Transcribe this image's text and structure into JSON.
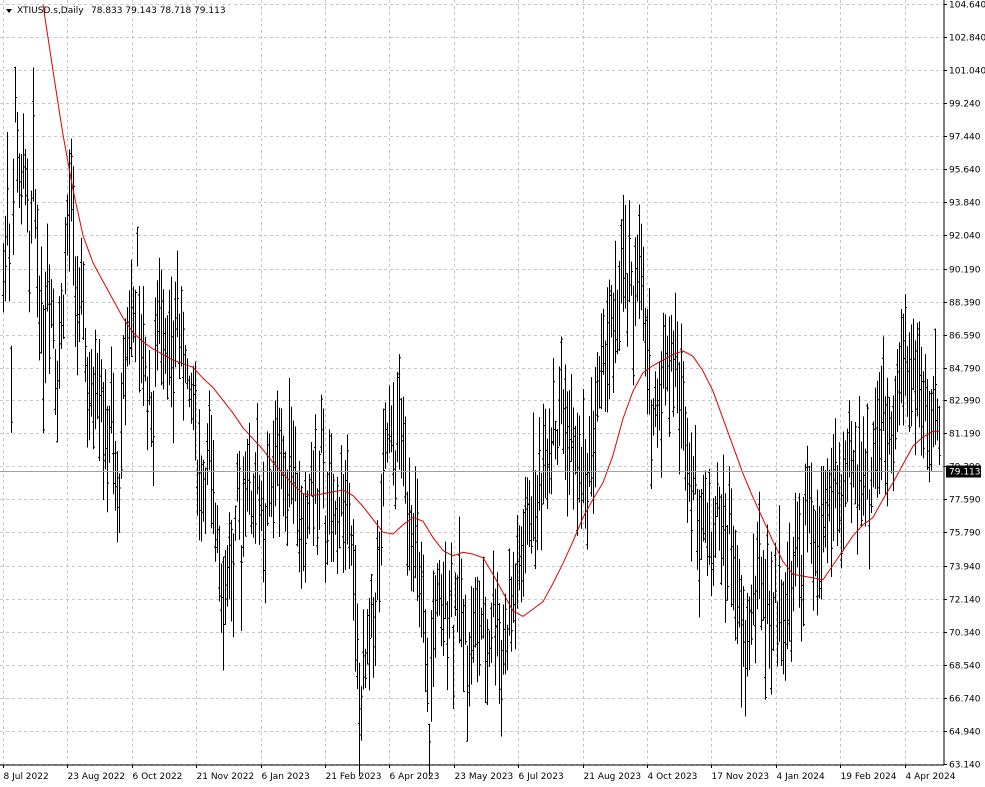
{
  "header": {
    "symbol": "XTIUSD.s,Daily",
    "ohlc": "78.833 79.143 78.718 79.113"
  },
  "price_tag": "79.113",
  "colors": {
    "bars": "#000000",
    "ma": "#e00000",
    "grid": "#c8c8c8",
    "background": "#ffffff"
  },
  "chart_data": {
    "type": "ohlc-bar",
    "series": [
      {
        "values": [
          [
            0,
            89
          ],
          [
            4,
            95
          ],
          [
            8,
            86
          ],
          [
            12,
            99
          ],
          [
            18,
            93
          ],
          [
            22,
            97
          ],
          [
            26,
            89
          ],
          [
            30,
            96
          ],
          [
            34,
            91
          ],
          [
            40,
            86
          ],
          [
            44,
            90
          ],
          [
            50,
            88
          ],
          [
            54,
            84
          ],
          [
            60,
            89
          ],
          [
            64,
            92
          ],
          [
            68,
            94
          ],
          [
            72,
            90
          ],
          [
            76,
            86
          ],
          [
            80,
            89
          ],
          [
            84,
            83
          ],
          [
            88,
            82
          ],
          [
            92,
            85
          ],
          [
            98,
            84
          ],
          [
            102,
            80
          ],
          [
            108,
            82
          ],
          [
            112,
            78
          ],
          [
            114,
            77
          ],
          [
            118,
            81
          ],
          [
            122,
            86
          ],
          [
            126,
            88
          ],
          [
            130,
            87
          ],
          [
            134,
            90
          ],
          [
            136,
            85
          ],
          [
            140,
            86
          ],
          [
            144,
            84
          ],
          [
            150,
            82
          ],
          [
            154,
            87
          ],
          [
            160,
            88
          ],
          [
            166,
            86
          ],
          [
            170,
            84
          ],
          [
            174,
            89
          ],
          [
            178,
            85
          ],
          [
            182,
            86
          ],
          [
            186,
            82
          ],
          [
            190,
            84
          ],
          [
            194,
            80
          ],
          [
            198,
            78
          ],
          [
            202,
            79
          ],
          [
            206,
            80
          ],
          [
            210,
            76
          ],
          [
            214,
            77
          ],
          [
            218,
            74
          ],
          [
            222,
            72
          ],
          [
            226,
            75
          ],
          [
            230,
            73
          ],
          [
            234,
            77
          ],
          [
            238,
            75
          ],
          [
            242,
            80
          ],
          [
            246,
            78
          ],
          [
            250,
            77
          ],
          [
            254,
            80
          ],
          [
            258,
            76
          ],
          [
            262,
            75
          ],
          [
            266,
            79
          ],
          [
            270,
            78
          ],
          [
            274,
            81
          ],
          [
            278,
            80
          ],
          [
            282,
            78
          ],
          [
            286,
            81
          ],
          [
            290,
            80
          ],
          [
            294,
            77
          ],
          [
            298,
            76
          ],
          [
            302,
            75
          ],
          [
            306,
            78
          ],
          [
            310,
            79
          ],
          [
            314,
            77
          ],
          [
            318,
            80
          ],
          [
            322,
            76
          ],
          [
            326,
            78
          ],
          [
            330,
            75
          ],
          [
            334,
            77
          ],
          [
            338,
            78
          ],
          [
            342,
            76
          ],
          [
            346,
            79
          ],
          [
            350,
            74
          ],
          [
            354,
            68
          ],
          [
            356,
            66
          ],
          [
            360,
            67
          ],
          [
            364,
            69
          ],
          [
            368,
            71
          ],
          [
            372,
            72
          ],
          [
            376,
            74
          ],
          [
            380,
            78
          ],
          [
            384,
            81
          ],
          [
            388,
            80
          ],
          [
            392,
            80
          ],
          [
            396,
            82
          ],
          [
            400,
            80
          ],
          [
            404,
            78
          ],
          [
            408,
            77
          ],
          [
            412,
            75
          ],
          [
            416,
            73
          ],
          [
            420,
            70
          ],
          [
            424,
            66
          ],
          [
            426,
            65
          ],
          [
            430,
            71
          ],
          [
            434,
            72
          ],
          [
            438,
            70
          ],
          [
            442,
            72
          ],
          [
            446,
            73
          ],
          [
            450,
            71
          ],
          [
            454,
            73
          ],
          [
            458,
            71
          ],
          [
            462,
            70
          ],
          [
            466,
            69
          ],
          [
            470,
            71
          ],
          [
            474,
            70
          ],
          [
            478,
            71
          ],
          [
            482,
            69
          ],
          [
            486,
            70
          ],
          [
            490,
            72
          ],
          [
            494,
            71
          ],
          [
            498,
            69
          ],
          [
            502,
            70
          ],
          [
            506,
            71
          ],
          [
            510,
            72
          ],
          [
            514,
            73
          ],
          [
            518,
            74
          ],
          [
            522,
            75
          ],
          [
            526,
            77
          ],
          [
            530,
            78
          ],
          [
            534,
            77
          ],
          [
            538,
            79
          ],
          [
            542,
            80
          ],
          [
            546,
            81
          ],
          [
            550,
            82
          ],
          [
            554,
            81
          ],
          [
            558,
            83
          ],
          [
            562,
            82
          ],
          [
            566,
            81
          ],
          [
            570,
            80
          ],
          [
            574,
            79
          ],
          [
            578,
            80
          ],
          [
            582,
            78
          ],
          [
            586,
            80
          ],
          [
            590,
            81
          ],
          [
            594,
            83
          ],
          [
            598,
            84
          ],
          [
            602,
            86
          ],
          [
            606,
            87
          ],
          [
            610,
            86
          ],
          [
            614,
            88
          ],
          [
            618,
            89
          ],
          [
            622,
            90
          ],
          [
            626,
            89
          ],
          [
            630,
            88
          ],
          [
            634,
            91
          ],
          [
            638,
            89
          ],
          [
            642,
            86
          ],
          [
            646,
            84
          ],
          [
            650,
            82
          ],
          [
            654,
            83
          ],
          [
            658,
            84
          ],
          [
            662,
            86
          ],
          [
            666,
            85
          ],
          [
            670,
            86
          ],
          [
            674,
            84
          ],
          [
            678,
            83
          ],
          [
            682,
            82
          ],
          [
            686,
            80
          ],
          [
            690,
            79
          ],
          [
            694,
            76
          ],
          [
            698,
            77
          ],
          [
            702,
            76
          ],
          [
            706,
            76
          ],
          [
            710,
            75
          ],
          [
            714,
            77
          ],
          [
            718,
            76
          ],
          [
            722,
            75
          ],
          [
            726,
            76
          ],
          [
            730,
            74
          ],
          [
            734,
            72
          ],
          [
            738,
            70
          ],
          [
            742,
            69
          ],
          [
            746,
            71
          ],
          [
            750,
            72
          ],
          [
            754,
            74
          ],
          [
            758,
            73
          ],
          [
            762,
            72
          ],
          [
            766,
            71
          ],
          [
            770,
            71
          ],
          [
            774,
            72
          ],
          [
            778,
            73
          ],
          [
            782,
            71
          ],
          [
            786,
            72
          ],
          [
            790,
            73
          ],
          [
            794,
            75
          ],
          [
            798,
            74
          ],
          [
            802,
            76
          ],
          [
            806,
            77
          ],
          [
            810,
            75
          ],
          [
            814,
            74
          ],
          [
            818,
            76
          ],
          [
            822,
            78
          ],
          [
            826,
            77
          ],
          [
            830,
            78
          ],
          [
            834,
            78
          ],
          [
            838,
            77
          ],
          [
            842,
            78
          ],
          [
            846,
            79
          ],
          [
            850,
            79
          ],
          [
            854,
            79
          ],
          [
            858,
            80
          ],
          [
            862,
            79
          ],
          [
            866,
            78
          ],
          [
            870,
            80
          ],
          [
            874,
            81
          ],
          [
            878,
            82
          ],
          [
            882,
            81
          ],
          [
            886,
            82
          ],
          [
            890,
            83
          ],
          [
            894,
            83
          ],
          [
            898,
            85
          ],
          [
            902,
            86
          ],
          [
            906,
            85
          ],
          [
            910,
            84
          ],
          [
            914,
            85
          ],
          [
            918,
            83
          ],
          [
            922,
            82
          ],
          [
            926,
            81
          ],
          [
            930,
            83
          ],
          [
            934,
            82
          ],
          [
            937,
            79.113
          ]
        ]
      }
    ],
    "y_axis": {
      "ticks": [
        "104.640",
        "102.840",
        "101.040",
        "99.240",
        "97.440",
        "95.640",
        "93.840",
        "92.040",
        "90.190",
        "88.390",
        "86.590",
        "84.790",
        "82.990",
        "81.190",
        "79.390",
        "77.590",
        "75.790",
        "73.940",
        "72.140",
        "70.340",
        "68.540",
        "66.740",
        "64.940",
        "63.140"
      ],
      "min": 63.14,
      "max": 104.64
    },
    "x_axis": {
      "ticks": [
        "8 Jul 2022",
        "23 Aug 2022",
        "6 Oct 2022",
        "21 Nov 2022",
        "6 Jan 2023",
        "21 Feb 2023",
        "6 Apr 2023",
        "23 May 2023",
        "6 Jul 2023",
        "21 Aug 2023",
        "4 Oct 2023",
        "17 Nov 2023",
        "4 Jan 2024",
        "19 Feb 2024",
        "4 Apr 2024"
      ]
    },
    "moving_average": [
      [
        40,
        104.6
      ],
      [
        50,
        101
      ],
      [
        60,
        97.5
      ],
      [
        70,
        94.5
      ],
      [
        80,
        92
      ],
      [
        90,
        90.5
      ],
      [
        100,
        89.5
      ],
      [
        110,
        88.5
      ],
      [
        120,
        87.5
      ],
      [
        130,
        86.7
      ],
      [
        140,
        86.2
      ],
      [
        150,
        85.8
      ],
      [
        160,
        85.5
      ],
      [
        170,
        85.2
      ],
      [
        180,
        85
      ],
      [
        190,
        84.8
      ],
      [
        200,
        84.2
      ],
      [
        210,
        83.7
      ],
      [
        220,
        83
      ],
      [
        230,
        82.3
      ],
      [
        240,
        81.5
      ],
      [
        250,
        80.9
      ],
      [
        260,
        80.3
      ],
      [
        270,
        79.6
      ],
      [
        280,
        79
      ],
      [
        290,
        78.4
      ],
      [
        300,
        77.9
      ],
      [
        310,
        77.8
      ],
      [
        320,
        77.9
      ],
      [
        330,
        78
      ],
      [
        340,
        78.1
      ],
      [
        350,
        77.8
      ],
      [
        360,
        77.2
      ],
      [
        370,
        76.5
      ],
      [
        380,
        75.8
      ],
      [
        390,
        75.7
      ],
      [
        400,
        76.2
      ],
      [
        410,
        76.6
      ],
      [
        420,
        76.4
      ],
      [
        430,
        75.5
      ],
      [
        440,
        74.8
      ],
      [
        450,
        74.5
      ],
      [
        460,
        74.7
      ],
      [
        470,
        74.6
      ],
      [
        480,
        74.4
      ],
      [
        490,
        73.5
      ],
      [
        500,
        72.5
      ],
      [
        510,
        71.5
      ],
      [
        520,
        71.2
      ],
      [
        530,
        71.6
      ],
      [
        540,
        72
      ],
      [
        550,
        73
      ],
      [
        560,
        74.1
      ],
      [
        570,
        75.3
      ],
      [
        580,
        76.6
      ],
      [
        590,
        77.6
      ],
      [
        600,
        78.5
      ],
      [
        610,
        80
      ],
      [
        620,
        82
      ],
      [
        630,
        83.5
      ],
      [
        640,
        84.5
      ],
      [
        650,
        84.9
      ],
      [
        660,
        85.2
      ],
      [
        670,
        85.5
      ],
      [
        680,
        85.7
      ],
      [
        690,
        85.4
      ],
      [
        700,
        84.6
      ],
      [
        710,
        83.5
      ],
      [
        720,
        82
      ],
      [
        730,
        80.5
      ],
      [
        740,
        79
      ],
      [
        750,
        77.7
      ],
      [
        760,
        76.5
      ],
      [
        770,
        75.3
      ],
      [
        780,
        74.2
      ],
      [
        790,
        73.5
      ],
      [
        800,
        73.4
      ],
      [
        810,
        73.3
      ],
      [
        820,
        73.2
      ],
      [
        830,
        74
      ],
      [
        840,
        74.8
      ],
      [
        850,
        75.6
      ],
      [
        860,
        76.2
      ],
      [
        870,
        76.6
      ],
      [
        880,
        77.6
      ],
      [
        890,
        78.5
      ],
      [
        900,
        79.5
      ],
      [
        910,
        80.5
      ],
      [
        920,
        81
      ],
      [
        930,
        81.3
      ],
      [
        937,
        81.3
      ]
    ]
  }
}
